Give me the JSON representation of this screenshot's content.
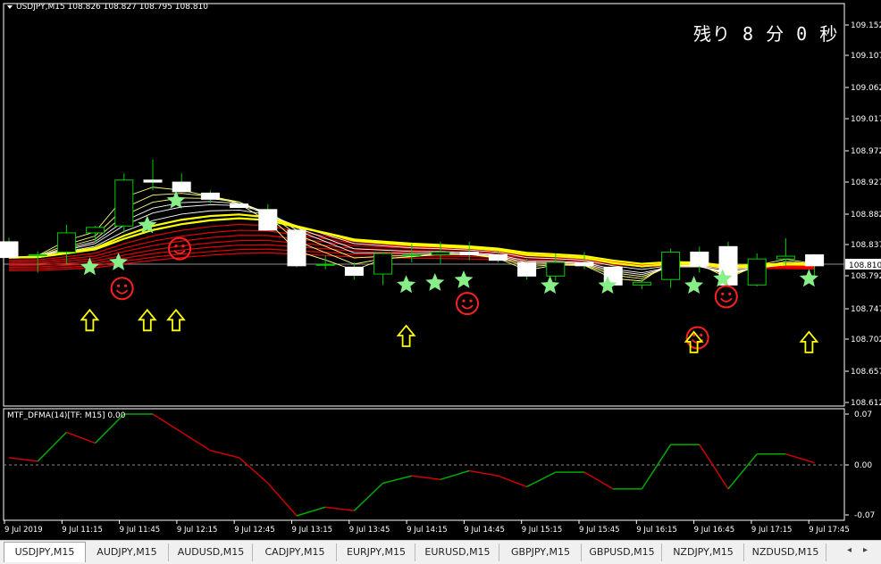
{
  "window": {
    "title": "USDJPY,M15  108.826 108.827 108.795 108.810",
    "timer": "残り 8 分 0 秒",
    "indicator_title": "MTF_DFMA(14)[TF: M15] 0.00"
  },
  "colors": {
    "background": "#000000",
    "bull_candle": "#ffffff",
    "bear_candle": "#ffffff",
    "wick": "#00cc00",
    "price_line": "#c0c0c0",
    "ma_fast": "#ffff00",
    "ma_slow": "#ff0000",
    "ind_up": "#00aa00",
    "ind_down": "#cc0000",
    "star": "#88ee88",
    "smiley": "#ff2020",
    "arrow": "#ffff00"
  },
  "price_axis": {
    "labels": [
      "109.152",
      "109.107",
      "109.062",
      "109.017",
      "108.972",
      "108.927",
      "108.882",
      "108.837",
      "108.810",
      "108.792",
      "108.747",
      "108.702",
      "108.657",
      "108.612"
    ],
    "current": "108.810"
  },
  "indicator_axis": {
    "labels": [
      "0.07",
      "0.00",
      "-0.07"
    ]
  },
  "time_axis": {
    "labels": [
      "9 Jul 2019",
      "9 Jul 11:15",
      "9 Jul 11:45",
      "9 Jul 12:15",
      "9 Jul 12:45",
      "9 Jul 13:15",
      "9 Jul 13:45",
      "9 Jul 14:15",
      "9 Jul 14:45",
      "9 Jul 15:15",
      "9 Jul 15:45",
      "9 Jul 16:15",
      "9 Jul 16:45",
      "9 Jul 17:15",
      "9 Jul 17:45"
    ]
  },
  "tabs": [
    {
      "label": "USDJPY,M15",
      "active": true
    },
    {
      "label": "AUDJPY,M15",
      "active": false
    },
    {
      "label": "AUDUSD,M15",
      "active": false
    },
    {
      "label": "CADJPY,M15",
      "active": false
    },
    {
      "label": "EURJPY,M15",
      "active": false
    },
    {
      "label": "EURUSD,M15",
      "active": false
    },
    {
      "label": "GBPJPY,M15",
      "active": false
    },
    {
      "label": "GBPUSD,M15",
      "active": false
    },
    {
      "label": "NZDJPY,M15",
      "active": false
    },
    {
      "label": "NZDUSD,M15",
      "active": false
    }
  ],
  "scroll": {
    "left": "◂",
    "right": "▸"
  },
  "chart_data": {
    "type": "candlestick",
    "candles": [
      {
        "o": 108.845,
        "h": 108.851,
        "l": 108.822,
        "c": 108.822
      },
      {
        "o": 108.826,
        "h": 108.831,
        "l": 108.8,
        "c": 108.826
      },
      {
        "o": 108.83,
        "h": 108.87,
        "l": 108.812,
        "c": 108.858
      },
      {
        "o": 108.858,
        "h": 108.868,
        "l": 108.845,
        "c": 108.866
      },
      {
        "o": 108.868,
        "h": 108.945,
        "l": 108.858,
        "c": 108.935
      },
      {
        "o": 108.935,
        "h": 108.965,
        "l": 108.92,
        "c": 108.932
      },
      {
        "o": 108.932,
        "h": 108.945,
        "l": 108.918,
        "c": 108.918
      },
      {
        "o": 108.916,
        "h": 108.92,
        "l": 108.901,
        "c": 108.907
      },
      {
        "o": 108.9,
        "h": 108.903,
        "l": 108.894,
        "c": 108.895
      },
      {
        "o": 108.892,
        "h": 108.9,
        "l": 108.862,
        "c": 108.862
      },
      {
        "o": 108.862,
        "h": 108.864,
        "l": 108.808,
        "c": 108.81
      },
      {
        "o": 108.812,
        "h": 108.825,
        "l": 108.805,
        "c": 108.812
      },
      {
        "o": 108.808,
        "h": 108.815,
        "l": 108.79,
        "c": 108.796
      },
      {
        "o": 108.798,
        "h": 108.83,
        "l": 108.782,
        "c": 108.828
      },
      {
        "o": 108.825,
        "h": 108.842,
        "l": 108.815,
        "c": 108.826
      },
      {
        "o": 108.826,
        "h": 108.845,
        "l": 108.812,
        "c": 108.83
      },
      {
        "o": 108.83,
        "h": 108.845,
        "l": 108.818,
        "c": 108.826
      },
      {
        "o": 108.826,
        "h": 108.832,
        "l": 108.815,
        "c": 108.818
      },
      {
        "o": 108.815,
        "h": 108.82,
        "l": 108.79,
        "c": 108.795
      },
      {
        "o": 108.795,
        "h": 108.828,
        "l": 108.788,
        "c": 108.815
      },
      {
        "o": 108.815,
        "h": 108.83,
        "l": 108.805,
        "c": 108.81
      },
      {
        "o": 108.808,
        "h": 108.812,
        "l": 108.78,
        "c": 108.782
      },
      {
        "o": 108.782,
        "h": 108.79,
        "l": 108.776,
        "c": 108.786
      },
      {
        "o": 108.79,
        "h": 108.835,
        "l": 108.778,
        "c": 108.83
      },
      {
        "o": 108.83,
        "h": 108.838,
        "l": 108.8,
        "c": 108.81
      },
      {
        "o": 108.838,
        "h": 108.845,
        "l": 108.781,
        "c": 108.782
      },
      {
        "o": 108.782,
        "h": 108.828,
        "l": 108.78,
        "c": 108.82
      },
      {
        "o": 108.82,
        "h": 108.85,
        "l": 108.81,
        "c": 108.824
      },
      {
        "o": 108.826,
        "h": 108.827,
        "l": 108.795,
        "c": 108.81
      }
    ],
    "indicator": [
      0.01,
      0.005,
      0.045,
      0.03,
      0.07,
      0.07,
      0.045,
      0.02,
      0.01,
      -0.025,
      -0.07,
      -0.058,
      -0.063,
      -0.025,
      -0.015,
      -0.02,
      -0.008,
      -0.015,
      -0.03,
      -0.01,
      -0.01,
      -0.033,
      -0.033,
      0.028,
      0.028,
      -0.033,
      0.015,
      0.015,
      0.003
    ],
    "ylim": [
      108.612,
      109.152
    ],
    "ind_ylim": [
      -0.07,
      0.07
    ],
    "stars": [
      2,
      3,
      4,
      5,
      13,
      14,
      15,
      18,
      20,
      23,
      24,
      27
    ],
    "star_prices": [
      108.808,
      108.815,
      108.869,
      108.905,
      108.782,
      108.785,
      108.789,
      108.781,
      108.781,
      108.781,
      108.791,
      108.791
    ],
    "smileys": [
      3,
      5,
      15,
      23,
      24
    ],
    "smiley_prices": [
      108.777,
      108.835,
      108.755,
      108.705,
      108.765
    ],
    "arrows": [
      2,
      4,
      5,
      13,
      23,
      27
    ],
    "arrow_prices": [
      108.73,
      108.73,
      108.73,
      108.707,
      108.698,
      108.698
    ]
  }
}
